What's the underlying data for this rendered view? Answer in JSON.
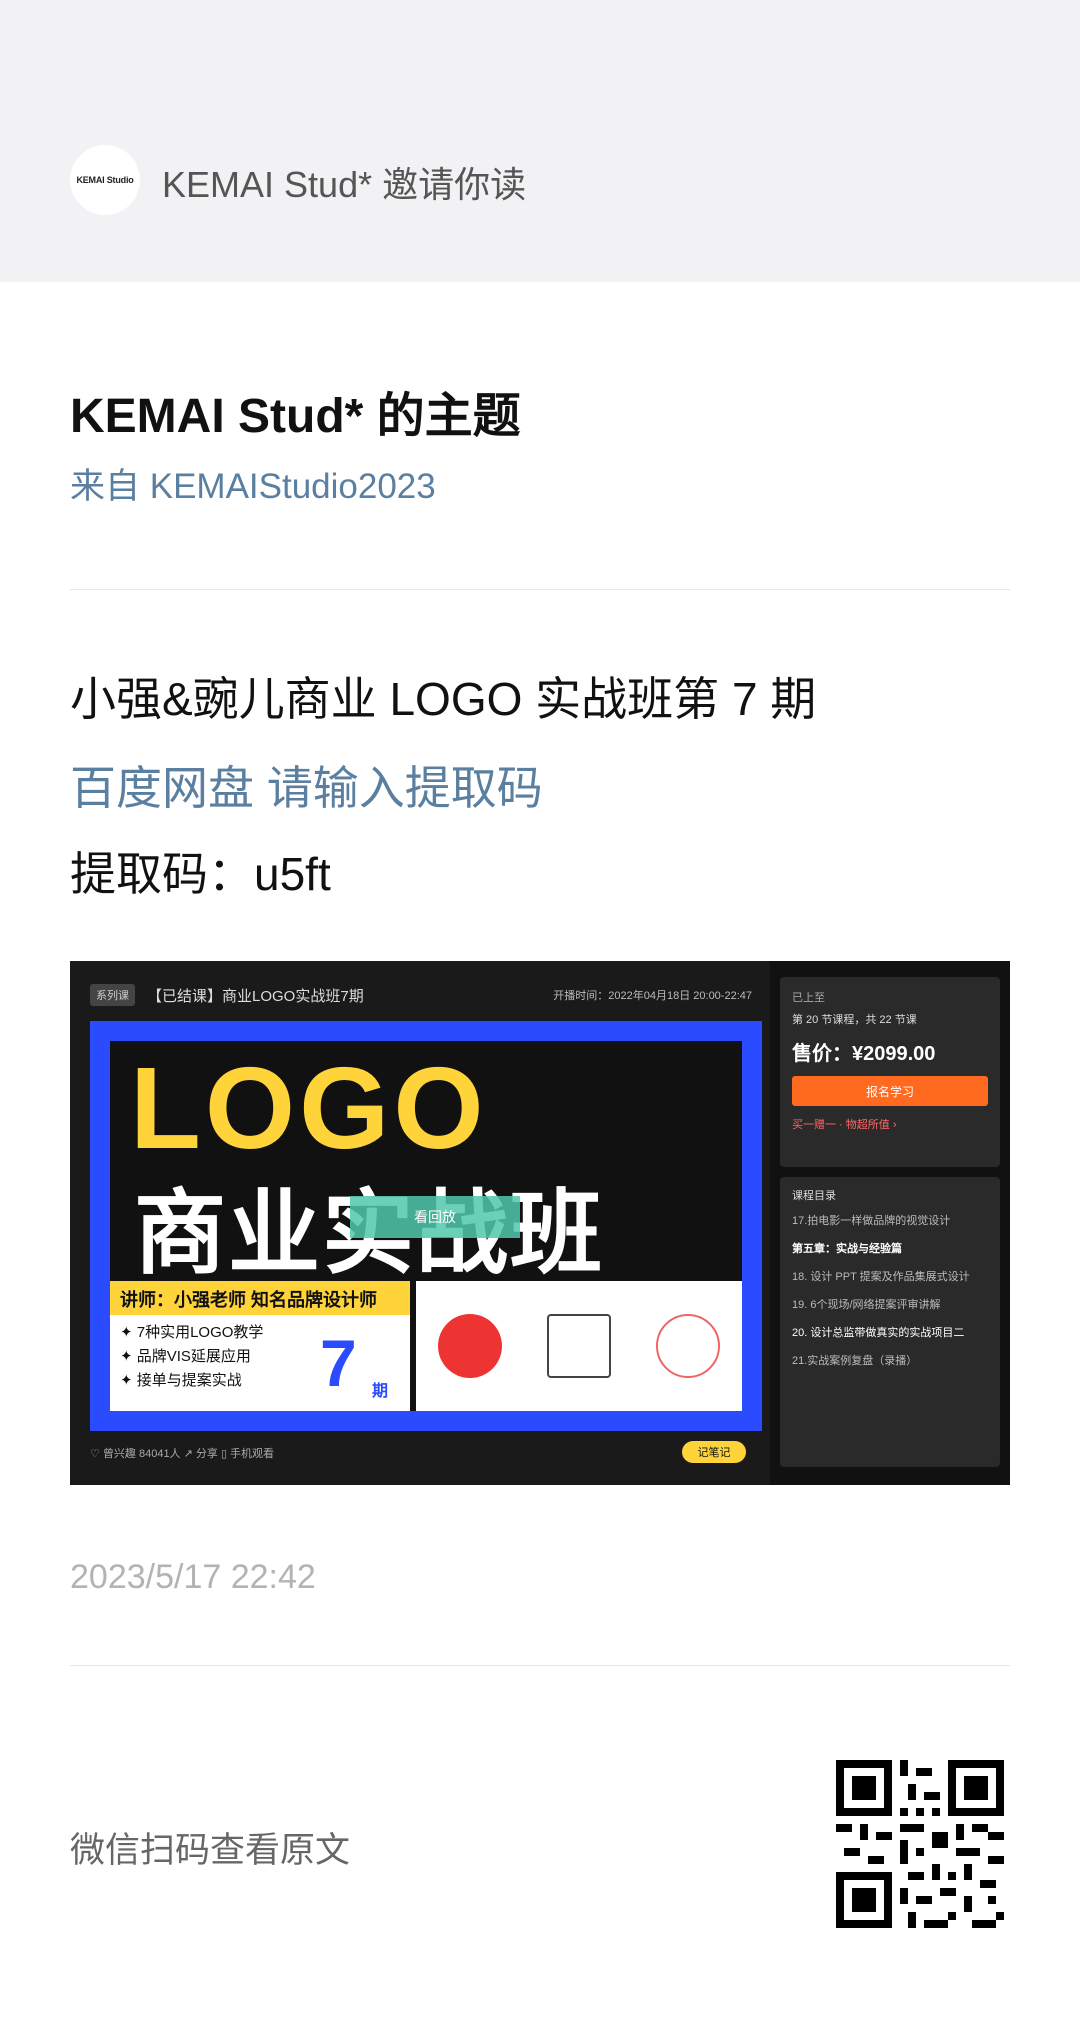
{
  "invite": {
    "avatar_text": "KEMAI Studio",
    "text": "KEMAI Stud* 邀请你读"
  },
  "topic": {
    "title": "KEMAI Stud* 的主题",
    "from": "来自 KEMAIStudio2023"
  },
  "post": {
    "title": "小强&豌儿商业 LOGO 实战班第 7 期",
    "link": "百度网盘 请输入提取码",
    "code": "提取码：u5ft"
  },
  "screenshot": {
    "series_tag": "系列课",
    "course_title": "【已结课】商业LOGO实战班7期",
    "live_time": "开播时间：2022年04月18日 20:00-22:47",
    "logo_word": "LOGO",
    "cn_title": "商业实战班",
    "replay": "看回放",
    "teacher_head": "讲师：小强老师  知名品牌设计师",
    "bullets": [
      "✦ 7种实用LOGO教学",
      "✦ 品牌VIS延展应用",
      "✦ 接单与提案实战"
    ],
    "issue_num": "7",
    "issue_unit": "期",
    "bottom_bar": "♡ 曾兴趣 84041人   ↗ 分享   ▯ 手机观看",
    "note_btn": "记笔记",
    "panel_status": "已上至",
    "lesson_count": "第 20 节课程，共 22 节课",
    "price": "售价：¥2099.00",
    "signup": "报名学习",
    "promo": "买一赠一 · 物超所值 ›",
    "catalog": "课程目录",
    "lessons": [
      "17.拍电影一样做品牌的视觉设计",
      "第五章：实战与经验篇",
      "18. 设计 PPT 提案及作品集展式设计",
      "19. 6个现场/网络提案评审讲解",
      "20. 设计总监带做真实的实战项目二",
      "21.实战案例复盘（录播）"
    ]
  },
  "timestamp": "2023/5/17 22:42",
  "scan_text": "微信扫码查看原文"
}
